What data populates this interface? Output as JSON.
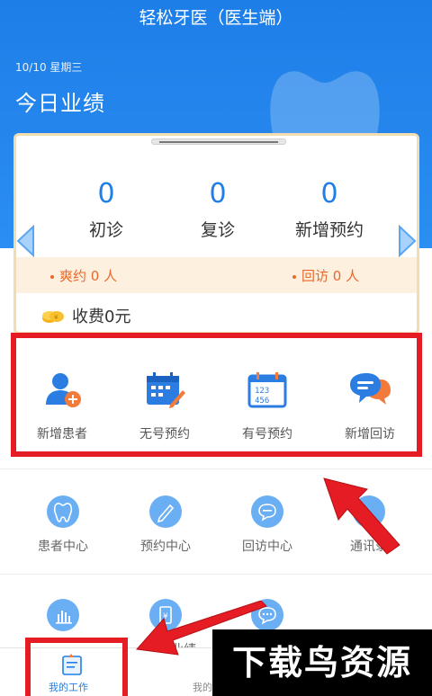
{
  "app": {
    "title": "轻松牙医（医生端）"
  },
  "header": {
    "date": "10/10 星期三",
    "title": "今日业绩"
  },
  "stats": [
    {
      "value": "0",
      "label": "初诊"
    },
    {
      "value": "0",
      "label": "复诊"
    },
    {
      "value": "0",
      "label": "新增预约"
    }
  ],
  "strip": {
    "left": "爽约 0 人",
    "right": "回访 0 人"
  },
  "fee": {
    "label": "收费0元"
  },
  "quick_actions": [
    {
      "label": "新增患者",
      "icon": "add-patient-icon"
    },
    {
      "label": "无号预约",
      "icon": "calendar-edit-icon"
    },
    {
      "label": "有号预约",
      "icon": "calendar-number-icon"
    },
    {
      "label": "新增回访",
      "icon": "chat-bubbles-icon"
    }
  ],
  "grid_row1": [
    {
      "label": "患者中心",
      "icon": "tooth-icon"
    },
    {
      "label": "预约中心",
      "icon": "pencil-icon"
    },
    {
      "label": "回访中心",
      "icon": "chat-icon"
    },
    {
      "label": "通讯录",
      "icon": "contacts-icon"
    }
  ],
  "grid_row2_partial": [
    {
      "label": "业绩",
      "icon": "document-icon"
    }
  ],
  "tabs": [
    {
      "label": "我的工作",
      "active": true
    },
    {
      "label": "我的"
    }
  ],
  "watermark": "下载鸟资源",
  "colors": {
    "primary": "#1f7ee8",
    "accent": "#e8692e",
    "highlight": "#e51c23",
    "strip": "#fdf0df"
  }
}
